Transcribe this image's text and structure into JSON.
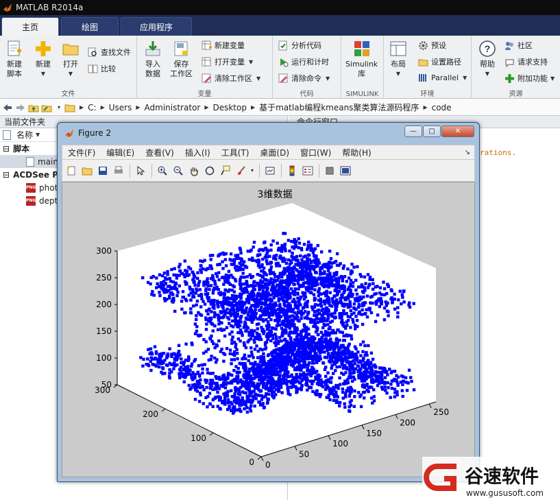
{
  "window": {
    "title": "MATLAB R2014a"
  },
  "ribbon": {
    "tabs": [
      "主页",
      "绘图",
      "应用程序"
    ],
    "groups": {
      "file": {
        "label": "文件",
        "new_script": "新建\n脚本",
        "new": "新建",
        "open": "打开",
        "find_files": "查找文件",
        "compare": "比较"
      },
      "variable": {
        "label": "变量",
        "import_data": "导入\n数据",
        "save_workspace": "保存\n工作区",
        "new_variable": "新建变量",
        "open_variable": "打开变量",
        "clear_workspace": "清除工作区"
      },
      "code": {
        "label": "代码",
        "analyze_code": "分析代码",
        "run_and_time": "运行和计时",
        "clear_commands": "清除命令"
      },
      "simulink": {
        "label": "SIMULINK",
        "simulink_library": "Simulink\n库"
      },
      "environment": {
        "label": "环境",
        "layout": "布局",
        "preferences": "预设",
        "set_path": "设置路径",
        "parallel": "Parallel"
      },
      "resources": {
        "label": "资源",
        "help": "帮助",
        "community": "社区",
        "request_support": "请求支持",
        "add_ons": "附加功能"
      }
    }
  },
  "address_bar": {
    "path": [
      "C:",
      "Users",
      "Administrator",
      "Desktop",
      "基于matlab编程kmeans聚类算法源码程序",
      "code"
    ]
  },
  "current_folder": {
    "title": "当前文件夹",
    "column_name": "名称",
    "sections": [
      {
        "label": "脚本",
        "items": [
          "main"
        ]
      },
      {
        "label": "ACDSee Pl",
        "items": [
          "photo",
          "dept"
        ]
      }
    ]
  },
  "command_window": {
    "title": "命令行窗口",
    "visible_text": "rations."
  },
  "figure": {
    "title": "Figure 2",
    "menu": [
      "文件(F)",
      "编辑(E)",
      "查看(V)",
      "插入(I)",
      "工具(T)",
      "桌面(D)",
      "窗口(W)",
      "帮助(H)"
    ],
    "toolbar_icons": [
      "new-figure-icon",
      "open-icon",
      "save-icon",
      "print-icon",
      "pointer-icon",
      "zoom-in-icon",
      "zoom-out-icon",
      "pan-icon",
      "rotate-3d-icon",
      "data-cursor-icon",
      "brush-icon",
      "link-icon",
      "colorbar-icon",
      "legend-icon",
      "hide-plot-tools-icon",
      "show-plot-tools-icon"
    ],
    "window_buttons": [
      "minimize",
      "maximize",
      "close"
    ]
  },
  "chart_data": {
    "type": "scatter",
    "subtype": "3d",
    "title": "3维数据",
    "xlabel": "",
    "ylabel": "",
    "zlabel": "",
    "x_ticks": [
      0,
      50,
      100,
      150,
      200,
      250
    ],
    "y_ticks": [
      0,
      100,
      200,
      300
    ],
    "z_ticks": [
      50,
      100,
      150,
      200,
      250,
      300
    ],
    "xlim": [
      0,
      260
    ],
    "ylim": [
      0,
      300
    ],
    "zlim": [
      50,
      300
    ],
    "marker_color": "#0000ff",
    "grid": false,
    "note_points": "dense blue point cloud (scattered surface) spanning x 0–250, y 0–300, z ~80–250"
  },
  "watermark": {
    "text": "谷速软件",
    "url": "www.gususoft.com"
  },
  "colors": {
    "tab_bar": "#1f2e55",
    "ribbon": "#eef0f2",
    "figure_frame": "#a9c3de",
    "plot_bg": "#cbcbcb",
    "points": "#0000ff",
    "accent_red": "#d52b1e"
  }
}
